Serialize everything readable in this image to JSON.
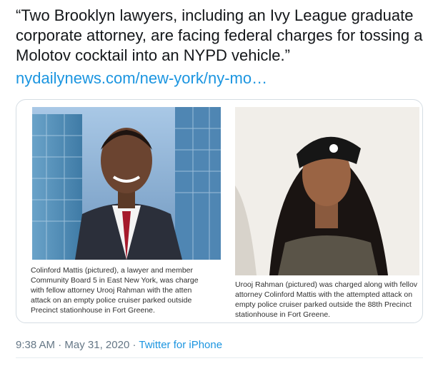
{
  "tweet": {
    "text": "“Two Brooklyn lawyers, including an Ivy League graduate corporate attorney, are facing federal charges for tossing a Molotov cocktail into an NYPD vehicle.”",
    "link": "nydailynews.com/new-york/ny-mo…"
  },
  "card": {
    "left_caption": "Colinford Mattis (pictured), a lawyer and member\nCommunity Board 5 in East New York, was charge\nwith fellow attorney Urooj Rahman with the atten\nattack on an empty police cruiser parked outside\nPrecinct stationhouse in Fort Greene.",
    "right_caption": "Urooj Rahman (pictured) was charged along with fellov\nattorney Colinford Mattis with the attempted attack on\nempty police cruiser parked outside the 88th Precinct\nstationhouse in Fort Greene."
  },
  "meta": {
    "time": "9:38 AM",
    "sep1": " · ",
    "date": "May 31, 2020",
    "sep2": " · ",
    "source": "Twitter for iPhone"
  }
}
